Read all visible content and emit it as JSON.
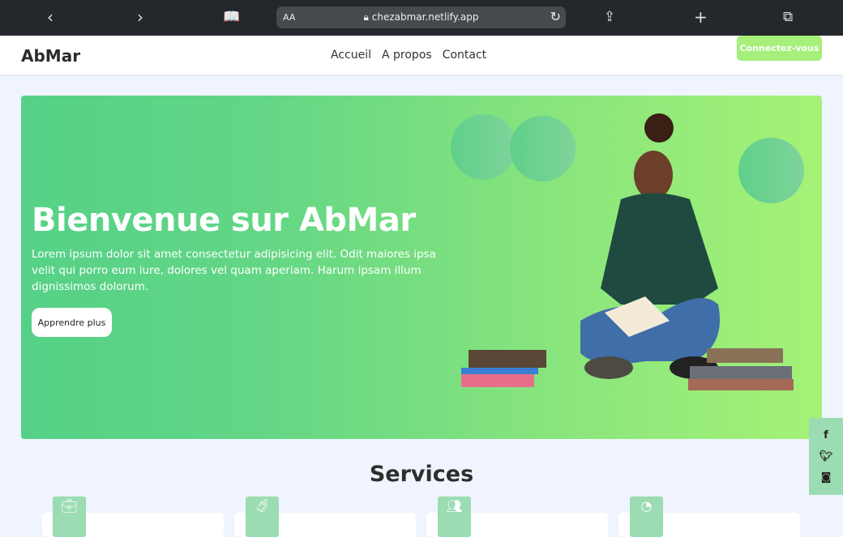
{
  "browser": {
    "url": "chezabmar.netlify.app",
    "text_size": "AA",
    "icons": [
      "back-icon",
      "forward-icon",
      "bookmarks-icon",
      "lock-icon",
      "reload-icon",
      "share-icon",
      "new-tab-icon",
      "tabs-icon"
    ]
  },
  "nav": {
    "logo": "AbMar",
    "links": [
      "Accueil",
      "A propos",
      "Contact"
    ],
    "cta": "Connectez-vous"
  },
  "hero": {
    "title": "Bienvenue sur AbMar",
    "description": "Lorem ipsum dolor sit amet consectetur adipisicing elit. Odit maiores ipsa velit qui porro eum iure, dolores vel quam aperiam. Harum ipsam illum dignissimos dolorum.",
    "button": "Apprendre plus"
  },
  "services": {
    "title": "Services",
    "cards": [
      {
        "icon": "briefcase-icon"
      },
      {
        "icon": "luggage-cart-icon"
      },
      {
        "icon": "users-cog-icon"
      },
      {
        "icon": "chart-pie-icon"
      }
    ]
  },
  "social": [
    "facebook-icon",
    "twitter-icon",
    "instagram-icon"
  ],
  "colors": {
    "accent": "#a5ef7a",
    "gradient_start": "#55d187",
    "gradient_end": "#a5f276",
    "icon_bg": "#9bdcb3",
    "background": "#eff4fe"
  }
}
